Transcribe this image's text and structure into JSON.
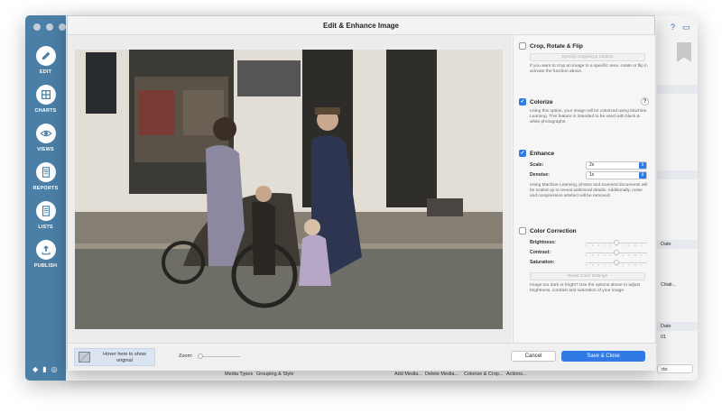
{
  "sidebar": {
    "items": [
      {
        "label": "EDIT",
        "icon": "pencil-icon"
      },
      {
        "label": "CHARTS",
        "icon": "charts-icon"
      },
      {
        "label": "VIEWS",
        "icon": "eye-icon"
      },
      {
        "label": "REPORTS",
        "icon": "document-icon"
      },
      {
        "label": "LISTS",
        "icon": "list-icon"
      },
      {
        "label": "PUBLISH",
        "icon": "upload-icon"
      }
    ]
  },
  "background": {
    "help_glyph": "?",
    "col_date_1": "Date",
    "col_citation": "Citati...",
    "col_date_2": "Date",
    "row_tail": "01",
    "dropdown_tail": "rto",
    "bottom_bar": {
      "media_types": "Media Types",
      "grouping": "Grouping & Style",
      "add_media": "Add Media...",
      "delete_media": "Delete Media...",
      "colorize_crop": "Colorize & Crop...",
      "actions": "Actions..."
    }
  },
  "dialog": {
    "title": "Edit & Enhance Image",
    "crop": {
      "title": "Crop, Rotate & Flip",
      "checked": false,
      "button": "Specify cropping & rotation",
      "description": "If you want to crop an image to a specific area, rotate or flip it, activate the function above."
    },
    "colorize": {
      "title": "Colorize",
      "checked": true,
      "help": "?",
      "description": "Using this option, your image will be colorized using Machine Learning. This feature is intended to be used with black & white photographs."
    },
    "enhance": {
      "title": "Enhance",
      "checked": true,
      "scale_label": "Scale:",
      "scale_value": "2x",
      "denoise_label": "Denoise:",
      "denoise_value": "1x",
      "description": "Using Machine Learning, photos and scanned documents will be scaled up to reveal additional details. Additionally, noise and compression artefact will be removed."
    },
    "color_correction": {
      "title": "Color Correction",
      "checked": false,
      "brightness_label": "Brightness:",
      "brightness_value": 0.5,
      "contrast_label": "Contrast:",
      "contrast_value": 0.5,
      "saturation_label": "Saturation:",
      "saturation_value": 0.5,
      "reset_button": "Reset Color Settings",
      "description": "Image too dark or bright? Use the options above to adjust brightness, contrast and saturation of your image."
    },
    "footer": {
      "hover_text": "Hover here to show original",
      "zoom_label": "Zoom:",
      "zoom_value": 0,
      "cancel": "Cancel",
      "save": "Save & Close"
    }
  },
  "colors": {
    "sidebar": "#4b7fa6",
    "accent": "#2f7ae5"
  }
}
